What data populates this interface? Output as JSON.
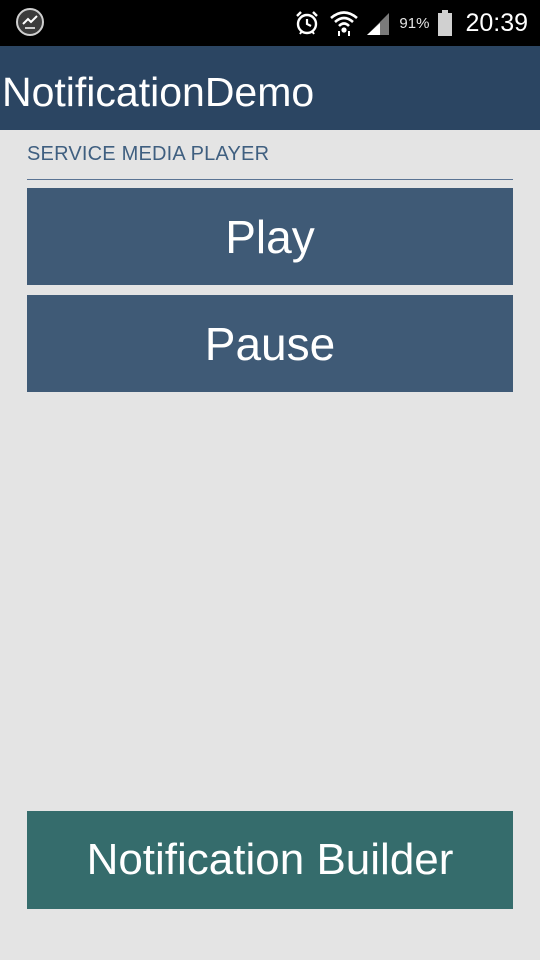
{
  "status_bar": {
    "left_icon": "app-notification-icon",
    "icons": [
      "alarm-icon",
      "wifi-icon",
      "signal-icon"
    ],
    "battery_percent": "91%",
    "time": "20:39"
  },
  "action_bar": {
    "title": "NotificationDemo"
  },
  "main": {
    "section_header": "SERVICE MEDIA PLAYER",
    "play_label": "Play",
    "pause_label": "Pause",
    "notification_builder_label": "Notification Builder"
  },
  "colors": {
    "action_bar": "#2b4562",
    "button": "#3f5a76",
    "notification_button": "#356c6c",
    "background": "#e4e4e4",
    "section_header": "#3f5f80"
  }
}
